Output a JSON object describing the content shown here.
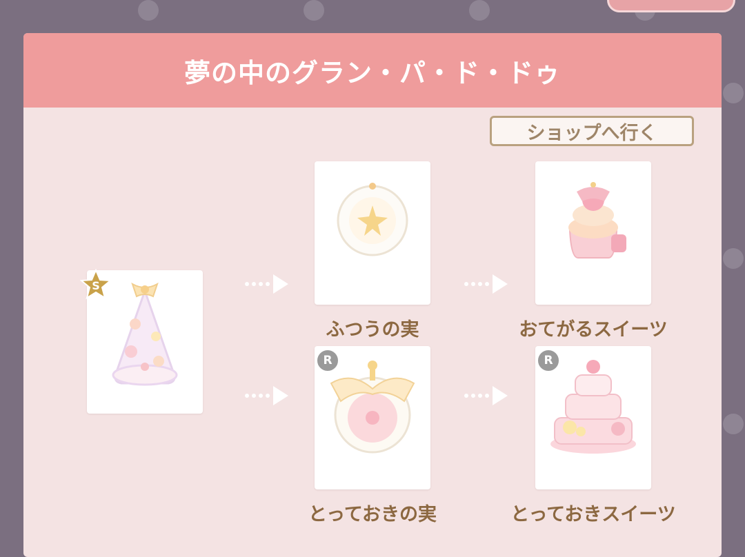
{
  "dialog": {
    "title": "夢の中のグラン・パ・ド・ドゥ",
    "shop_button": "ショップへ行く"
  },
  "source_item": {
    "rank": "S",
    "icon": "cake-tower-icon"
  },
  "routes": [
    {
      "ingredient": {
        "label": "ふつうの実",
        "icon": "star-fruit-icon",
        "rarity": ""
      },
      "result": {
        "label": "おてがるスイーツ",
        "icon": "cupcake-icon",
        "rarity": ""
      }
    },
    {
      "ingredient": {
        "label": "とっておきの実",
        "icon": "ribbon-fruit-icon",
        "rarity": "R"
      },
      "result": {
        "label": "とっておきスイーツ",
        "icon": "layer-cake-icon",
        "rarity": "R"
      }
    }
  ],
  "colors": {
    "header": "#ef9c9c",
    "panel": "#f4e3e3",
    "label": "#8c6841",
    "arrow": "#ffffff"
  }
}
